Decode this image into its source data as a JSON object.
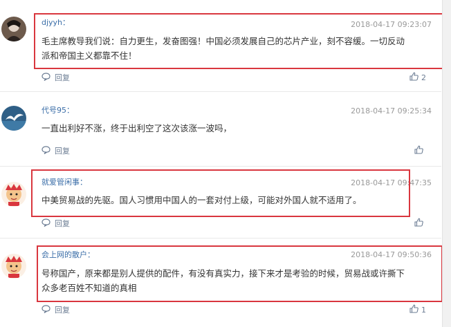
{
  "comments": [
    {
      "username": "djyyh：",
      "time": "2018-04-17 09:23:07",
      "text_line1": "毛主席教导我们说：自力更生，发奋图强！中国必须发展自己的芯片产业，刻不容缓。一切反动",
      "text_line2": "派和帝国主义都靠不住！",
      "reply_label": "回复",
      "likes": "2"
    },
    {
      "username": "代号95：",
      "time": "2018-04-17 09:25:34",
      "text_line1": "一直出利好不涨，终于出利空了这次该涨一波吗，",
      "reply_label": "回复",
      "likes": ""
    },
    {
      "username": "就爱管闲事：",
      "time": "2018-04-17 09:47:35",
      "text_line1": "中美贸易战的先驱。国人习惯用中国人的一套对付上级，可能对外国人就不适用了。",
      "reply_label": "回复",
      "likes": ""
    },
    {
      "username": "会上网的散户：",
      "time": "2018-04-17 09:50:36",
      "text_line1": "号称国产，原来都是别人提供的配件，有没有真实力，接下来才是考验的时候，贸易战或许撕下",
      "text_line2": "众多老百姓不知道的真相",
      "reply_label": "回复",
      "likes": "1"
    }
  ],
  "colors": {
    "highlight": "#d9363e",
    "username": "#3b6ea8",
    "meta": "#999999"
  },
  "icons": {
    "reply": "speech-bubble-icon",
    "like": "thumbs-up-icon"
  }
}
